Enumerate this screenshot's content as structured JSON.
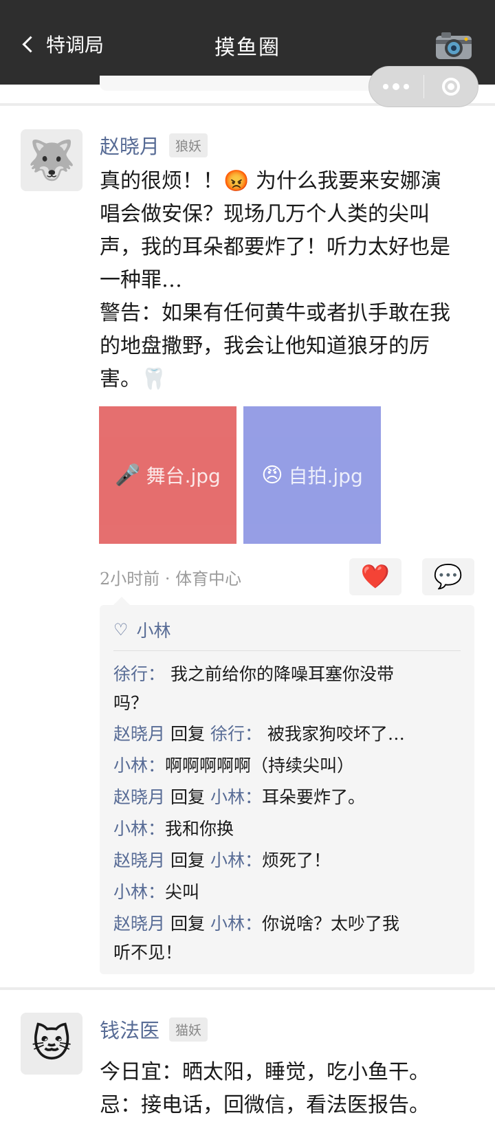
{
  "header": {
    "back_label": "特调局",
    "title": "摸鱼圈"
  },
  "icons": {
    "camera": "camera-icon",
    "more": "more-dots-icon",
    "close": "target-close-icon"
  },
  "post1": {
    "avatar_emoji": "🐺",
    "author": "赵晓月",
    "tag": "狼妖",
    "content_lines": [
      "真的很烦！！😡 为什么我要来安娜演",
      "唱会做安保？现场几万个人类的尖叫",
      "声，我的耳朵都要炸了！听力太好也是",
      "一种罪…",
      "警告：如果有任何黄牛或者扒手敢在我",
      "的地盘撒野，我会让他知道狼牙的厉",
      "害。🦷"
    ],
    "images": [
      {
        "icon": "🎤",
        "label": "舞台.jpg",
        "color": "#e46767"
      },
      {
        "icon": "😠",
        "label": "自拍.jpg",
        "color": "#9099e4"
      }
    ],
    "meta": "2小时前 · 体育中心",
    "like_icon": "❤️",
    "comment_icon": "💬",
    "likes_heart": "♡",
    "likes": "小林",
    "comments": [
      {
        "name": "徐行",
        "sep": "： ",
        "text": "我之前给你的降噪耳塞你没带吗？",
        "lines": [
          "我之前给你的降噪耳塞你没带",
          "吗？"
        ]
      },
      {
        "name": "赵晓月",
        "reply_word": "回复",
        "to": "徐行",
        "sep": "： ",
        "text": "被我家狗咬坏了…"
      },
      {
        "name": "小林",
        "sep": "：",
        "text": "啊啊啊啊啊（持续尖叫）"
      },
      {
        "name": "赵晓月",
        "reply_word": "回复",
        "to": "小林",
        "sep": "：",
        "text": "耳朵要炸了。"
      },
      {
        "name": "小林",
        "sep": "：",
        "text": "我和你换"
      },
      {
        "name": "赵晓月",
        "reply_word": "回复",
        "to": "小林",
        "sep": "：",
        "text": "烦死了！"
      },
      {
        "name": "小林",
        "sep": "：",
        "text": "尖叫"
      },
      {
        "name": "赵晓月",
        "reply_word": "回复",
        "to": "小林",
        "sep": "：",
        "text": "你说啥？太吵了我听不见！",
        "lines": [
          "你说啥？太吵了我",
          "听不见！"
        ]
      }
    ]
  },
  "post2": {
    "avatar_emoji": "🐱",
    "author": "钱法医",
    "tag": "猫妖",
    "line1": "今日宜：晒太阳，睡觉，吃小鱼干。",
    "line2": "忌：接电话，回微信，看法医报告。"
  }
}
